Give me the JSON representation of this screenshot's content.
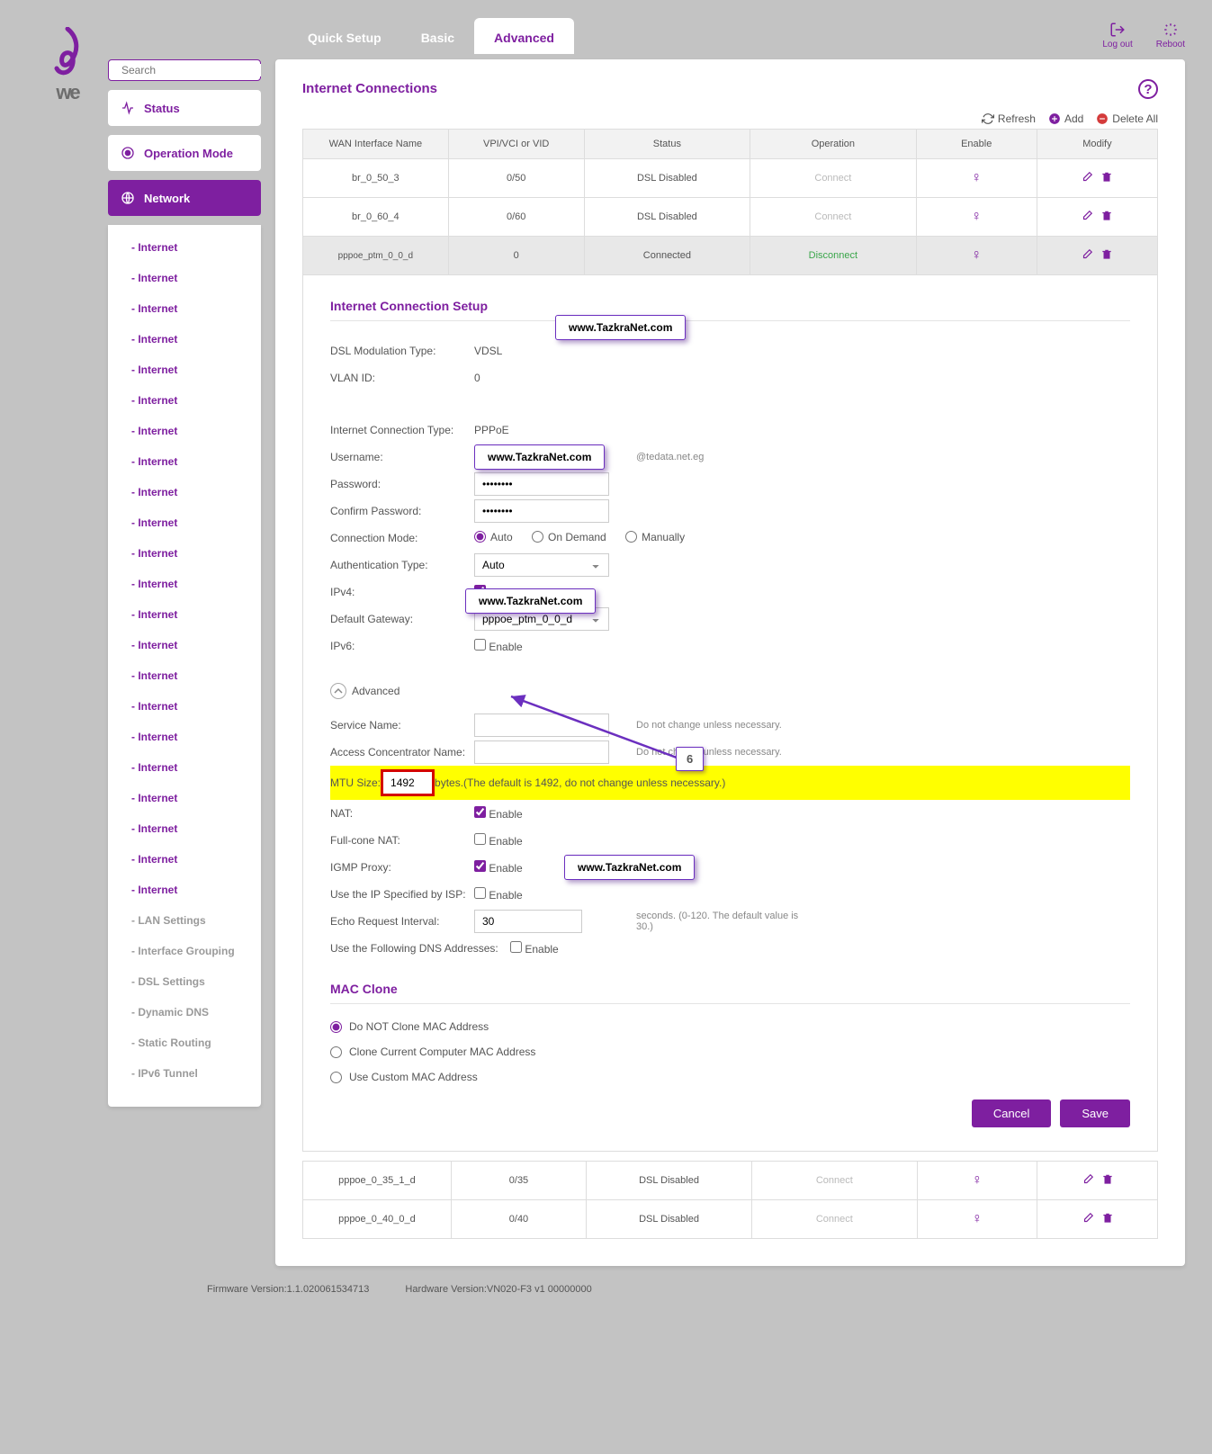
{
  "search": {
    "placeholder": "Search"
  },
  "topbar": {
    "logout": "Log out",
    "reboot": "Reboot"
  },
  "tabs": {
    "quick": "Quick Setup",
    "basic": "Basic",
    "advanced": "Advanced"
  },
  "sidebar": {
    "status": "Status",
    "opmode": "Operation Mode",
    "network": "Network",
    "internet": "- Internet",
    "lan": "- LAN Settings",
    "ifgroup": "- Interface Grouping",
    "dsl": "- DSL Settings",
    "ddns": "- Dynamic DNS",
    "static": "- Static Routing",
    "ipv6": "- IPv6 Tunnel"
  },
  "page": {
    "title": "Internet Connections"
  },
  "ops": {
    "refresh": "Refresh",
    "add": "Add",
    "delall": "Delete All"
  },
  "table": {
    "h1": "WAN Interface Name",
    "h2": "VPI/VCI or VID",
    "h3": "Status",
    "h4": "Operation",
    "h5": "Enable",
    "h6": "Modify",
    "r1": {
      "name": "br_0_50_3",
      "vpi": "0/50",
      "status": "DSL Disabled",
      "op": "Connect"
    },
    "r2": {
      "name": "br_0_60_4",
      "vpi": "0/60",
      "status": "DSL Disabled",
      "op": "Connect"
    },
    "r3": {
      "name": "pppoe_ptm_0_0_d",
      "vpi": "0",
      "status": "Connected",
      "op": "Disconnect"
    },
    "r4": {
      "name": "pppoe_0_35_1_d",
      "vpi": "0/35",
      "status": "DSL Disabled",
      "op": "Connect"
    },
    "r5": {
      "name": "pppoe_0_40_0_d",
      "vpi": "0/40",
      "status": "DSL Disabled",
      "op": "Connect"
    }
  },
  "setup": {
    "title": "Internet Connection Setup",
    "dsl_lbl": "DSL Modulation Type:",
    "dsl_val": "VDSL",
    "vlan_lbl": "VLAN ID:",
    "vlan_val": "0",
    "ict_lbl": "Internet Connection Type:",
    "ict_val": "PPPoE",
    "user_lbl": "Username:",
    "user_suffix": "@tedata.net.eg",
    "pass_lbl": "Password:",
    "pass_val": "••••••••",
    "cpass_lbl": "Confirm Password:",
    "cpass_val": "••••••••",
    "cmode_lbl": "Connection Mode:",
    "cmode_auto": "Auto",
    "cmode_ond": "On Demand",
    "cmode_man": "Manually",
    "auth_lbl": "Authentication Type:",
    "auth_val": "Auto",
    "ipv4_lbl": "IPv4:",
    "enable": "Enable",
    "gw_lbl": "Default Gateway:",
    "gw_val": "pppoe_ptm_0_0_d",
    "ipv6_lbl": "IPv6:",
    "adv_toggle": "Advanced",
    "svc_lbl": "Service Name:",
    "svc_hint": "Do not change unless necessary.",
    "acn_lbl": "Access Concentrator Name:",
    "acn_hint": "Do not change unless necessary.",
    "mtu_lbl": "MTU Size:",
    "mtu_val": "1492",
    "mtu_hint": "bytes.(The default is 1492, do not change unless necessary.)",
    "nat_lbl": "NAT:",
    "fc_lbl": "Full-cone NAT:",
    "igmp_lbl": "IGMP Proxy:",
    "isp_lbl": "Use the IP Specified by ISP:",
    "echo_lbl": "Echo Request Interval:",
    "echo_val": "30",
    "echo_hint": "seconds. (0-120. The default value is 30.)",
    "dns_lbl": "Use the Following DNS Addresses:"
  },
  "mac": {
    "title": "MAC Clone",
    "opt1": "Do NOT Clone MAC Address",
    "opt2": "Clone Current Computer MAC Address",
    "opt3": "Use Custom MAC Address"
  },
  "buttons": {
    "cancel": "Cancel",
    "save": "Save"
  },
  "wm": "www.TazkraNet.com",
  "step6": "6",
  "footer": {
    "fw": "Firmware Version:1.1.020061534713",
    "hw": "Hardware Version:VN020-F3 v1 00000000"
  }
}
